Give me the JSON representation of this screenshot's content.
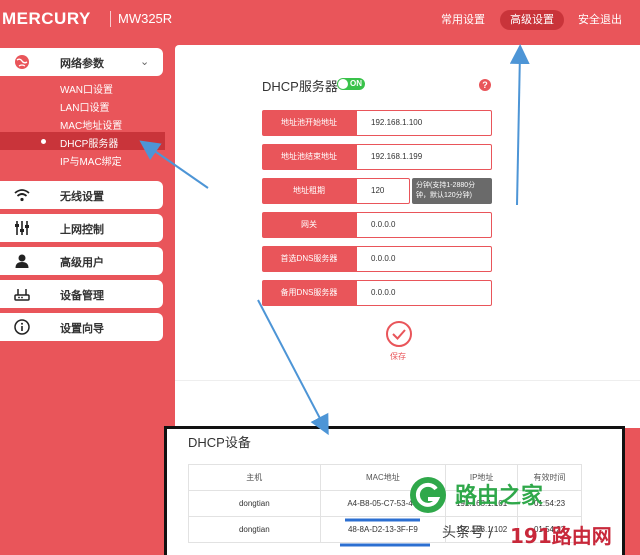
{
  "header": {
    "brand": "MERCURY",
    "model": "MW325R",
    "nav": [
      "常用设置",
      "高级设置",
      "安全退出"
    ],
    "active_nav_index": 1
  },
  "sidebar": {
    "groups": [
      {
        "label": "网络参数",
        "icon": "globe-icon",
        "expanded": true
      },
      {
        "label": "无线设置",
        "icon": "wifi-icon"
      },
      {
        "label": "上网控制",
        "icon": "sliders-icon"
      },
      {
        "label": "高级用户",
        "icon": "user-icon"
      },
      {
        "label": "设备管理",
        "icon": "router-icon"
      },
      {
        "label": "设置向导",
        "icon": "info-icon"
      }
    ],
    "subitems": [
      "WAN口设置",
      "LAN口设置",
      "MAC地址设置",
      "DHCP服务器",
      "IP与MAC绑定"
    ],
    "active_subitem_index": 3
  },
  "dhcp": {
    "title": "DHCP服务器",
    "toggle_label": "ON",
    "help": "?",
    "fields": [
      {
        "label": "地址池开始地址",
        "value": "192.168.1.100"
      },
      {
        "label": "地址池结束地址",
        "value": "192.168.1.199"
      },
      {
        "label": "地址租期",
        "value": "120",
        "hint": "分钟(支持1-2880分钟，默认120分钟)"
      },
      {
        "label": "网关",
        "value": "0.0.0.0"
      },
      {
        "label": "首选DNS服务器",
        "value": "0.0.0.0"
      },
      {
        "label": "备用DNS服务器",
        "value": "0.0.0.0"
      }
    ],
    "save_label": "保存"
  },
  "devices": {
    "title": "DHCP设备",
    "columns": [
      "主机",
      "MAC地址",
      "IP地址",
      "有效时间"
    ],
    "rows": [
      [
        "dongtian",
        "A4-B8-05-C7-53-4C",
        "192.168.1.101",
        "01:54:23"
      ],
      [
        "dongtian",
        "48-8A-D2-13-3F-F9",
        "192.168.1.102",
        "01:54:23"
      ]
    ]
  },
  "watermark": {
    "brand": "路由之家",
    "source": "头条号 / ",
    "domain": "191路由网"
  },
  "colors": {
    "primary": "#e9555a",
    "active": "#c9343a",
    "toggle_on": "#39c24a",
    "arrow": "#4d95d6"
  }
}
